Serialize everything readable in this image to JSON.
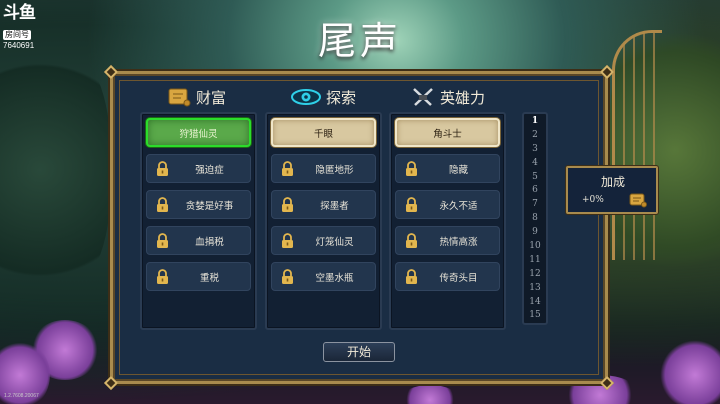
{
  "watermark": {
    "brand": "斗鱼",
    "room_label": "房间号",
    "room_id": "7640691"
  },
  "title": "尾声",
  "columns": [
    {
      "header": "财富",
      "icon": "scroll-icon",
      "selected": "狩猎仙灵",
      "locked": [
        "强迫症",
        "贪婪是好事",
        "血捐税",
        "重税"
      ]
    },
    {
      "header": "探索",
      "icon": "eye-icon",
      "selected": "千眼",
      "locked": [
        "隐匿地形",
        "探墨者",
        "灯笼仙灵",
        "空墨水瓶"
      ]
    },
    {
      "header": "英雄力",
      "icon": "crossed-swords-icon",
      "selected": "角斗士",
      "locked": [
        "隐藏",
        "永久不适",
        "热情高涨",
        "传奇头目"
      ]
    }
  ],
  "levels": [
    "1",
    "2",
    "3",
    "4",
    "5",
    "6",
    "7",
    "8",
    "9",
    "10",
    "11",
    "12",
    "13",
    "14",
    "15"
  ],
  "active_level": 1,
  "bonus": {
    "title": "加成",
    "value": "+0%",
    "icon": "scroll-icon"
  },
  "start_button": "开始",
  "version": "1.2.7608.20067",
  "colors": {
    "panel_bg": "#1a2d44",
    "frame_gold": "#a88b4e",
    "selected_card": "#d8c8a0",
    "green_card": "#5aa94a",
    "eye_cyan": "#2fd0e8"
  }
}
